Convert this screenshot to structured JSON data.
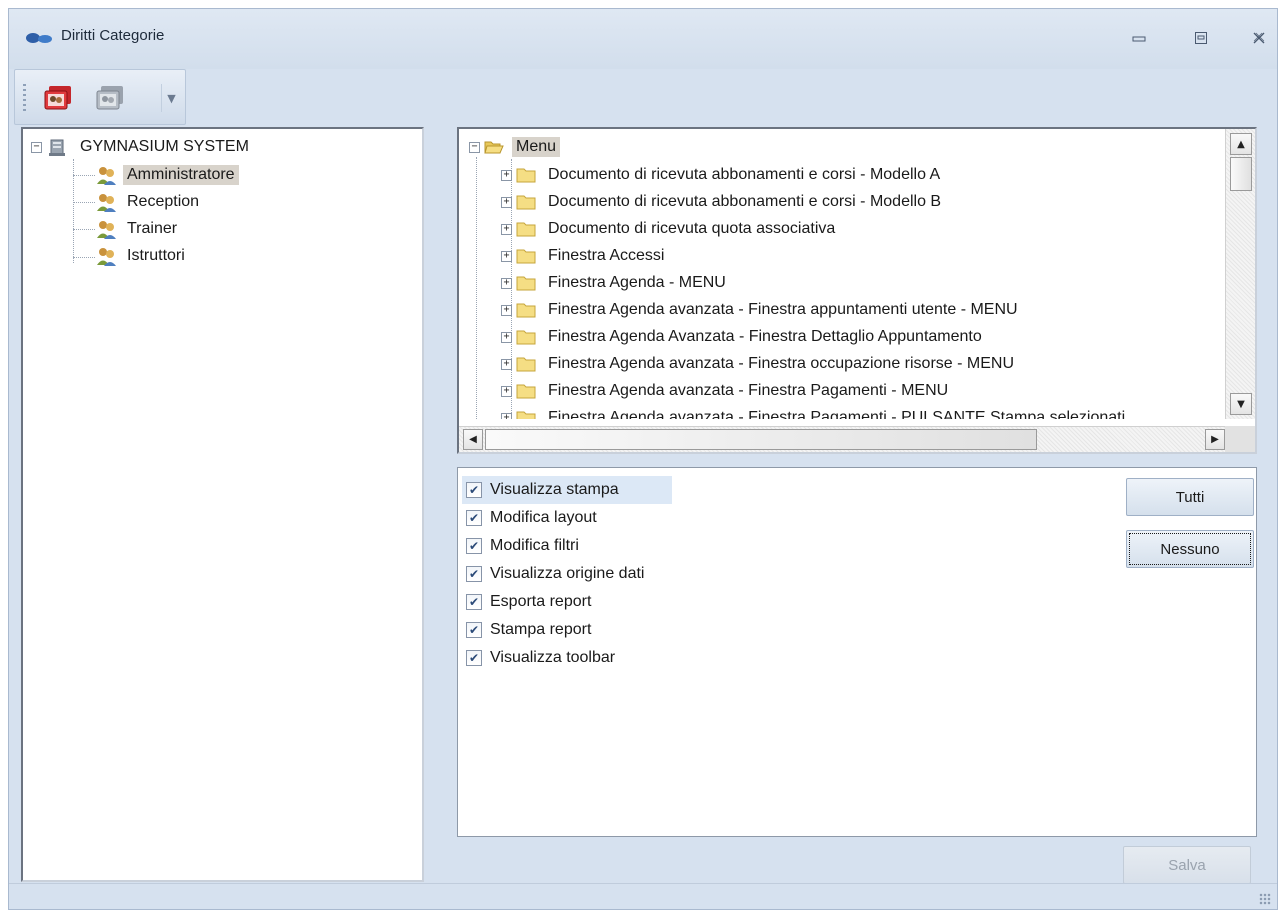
{
  "window": {
    "title": "Diritti Categorie",
    "controls": {
      "minimize": "minimize-icon",
      "maximize": "maximize-icon",
      "close": "close-icon"
    }
  },
  "toolbar": {
    "buttons": [
      {
        "icon": "user-group-red-icon",
        "enabled": true
      },
      {
        "icon": "user-group-gray-icon",
        "enabled": false
      }
    ],
    "dropdown_icon": "chevron-down-icon"
  },
  "categories": {
    "root": "GYMNASIUM SYSTEM",
    "items": [
      "Amministratore",
      "Reception",
      "Trainer",
      "Istruttori"
    ],
    "selected": "Amministratore"
  },
  "menu_tree": {
    "root": "Menu",
    "items": [
      "Documento di ricevuta abbonamenti e corsi - Modello A",
      "Documento di ricevuta abbonamenti e corsi - Modello B",
      "Documento di ricevuta quota associativa",
      "Finestra Accessi",
      "Finestra Agenda - MENU",
      "Finestra Agenda avanzata - Finestra appuntamenti utente - MENU",
      "Finestra Agenda Avanzata - Finestra Dettaglio Appuntamento",
      "Finestra Agenda avanzata - Finestra occupazione risorse - MENU",
      "Finestra Agenda avanzata - Finestra Pagamenti - MENU",
      "Finestra Agenda avanzata - Finestra Pagamenti - PULSANTE Stampa selezionati"
    ]
  },
  "permissions": {
    "items": [
      {
        "label": "Visualizza stampa",
        "checked": true
      },
      {
        "label": "Modifica layout",
        "checked": true
      },
      {
        "label": "Modifica filtri",
        "checked": true
      },
      {
        "label": "Visualizza origine dati",
        "checked": true
      },
      {
        "label": "Esporta report",
        "checked": true
      },
      {
        "label": "Stampa report",
        "checked": true
      },
      {
        "label": "Visualizza toolbar",
        "checked": true
      }
    ],
    "highlighted": "Visualizza stampa"
  },
  "buttons": {
    "all": "Tutti",
    "none": "Nessuno",
    "save": "Salva"
  }
}
